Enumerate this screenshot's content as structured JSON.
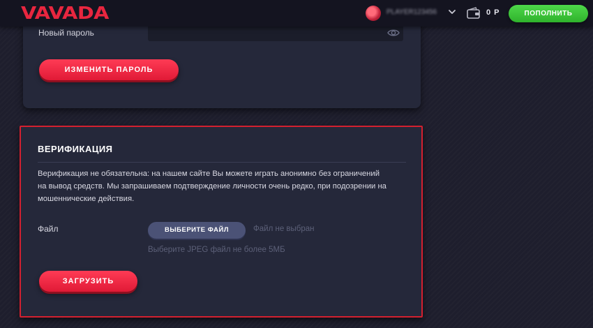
{
  "header": {
    "logo": "VAVADA",
    "username": "PLAYER123456",
    "balance": "0 Р",
    "deposit_label": "ПОПОЛНИТЬ"
  },
  "password_section": {
    "new_password_label": "Новый пароль",
    "new_password_value": "",
    "change_button": "ИЗМЕНИТЬ ПАРОЛЬ"
  },
  "verification": {
    "title": "ВЕРИФИКАЦИЯ",
    "description": "Верификация не обязательна: на нашем сайте Вы можете играть анонимно без ограничений на вывод средств. Мы запрашиваем подтверждение личности очень редко, при подозрении на мошеннические действия.",
    "file_label": "Файл",
    "choose_file_button": "ВЫБЕРИТЕ ФАЙЛ",
    "no_file_text": "Файл не выбран",
    "file_hint": "Выберите JPEG файл не более 5МБ",
    "upload_button": "ЗАГРУЗИТЬ"
  },
  "colors": {
    "brand_red": "#e8263f",
    "deposit_green": "#3cc439",
    "highlight_border": "#d4202f",
    "card_bg": "#25283a"
  },
  "icons": {
    "avatar": "user-avatar",
    "chevron": "chevron-down-icon",
    "wallet": "wallet-icon",
    "eye": "eye-icon"
  }
}
